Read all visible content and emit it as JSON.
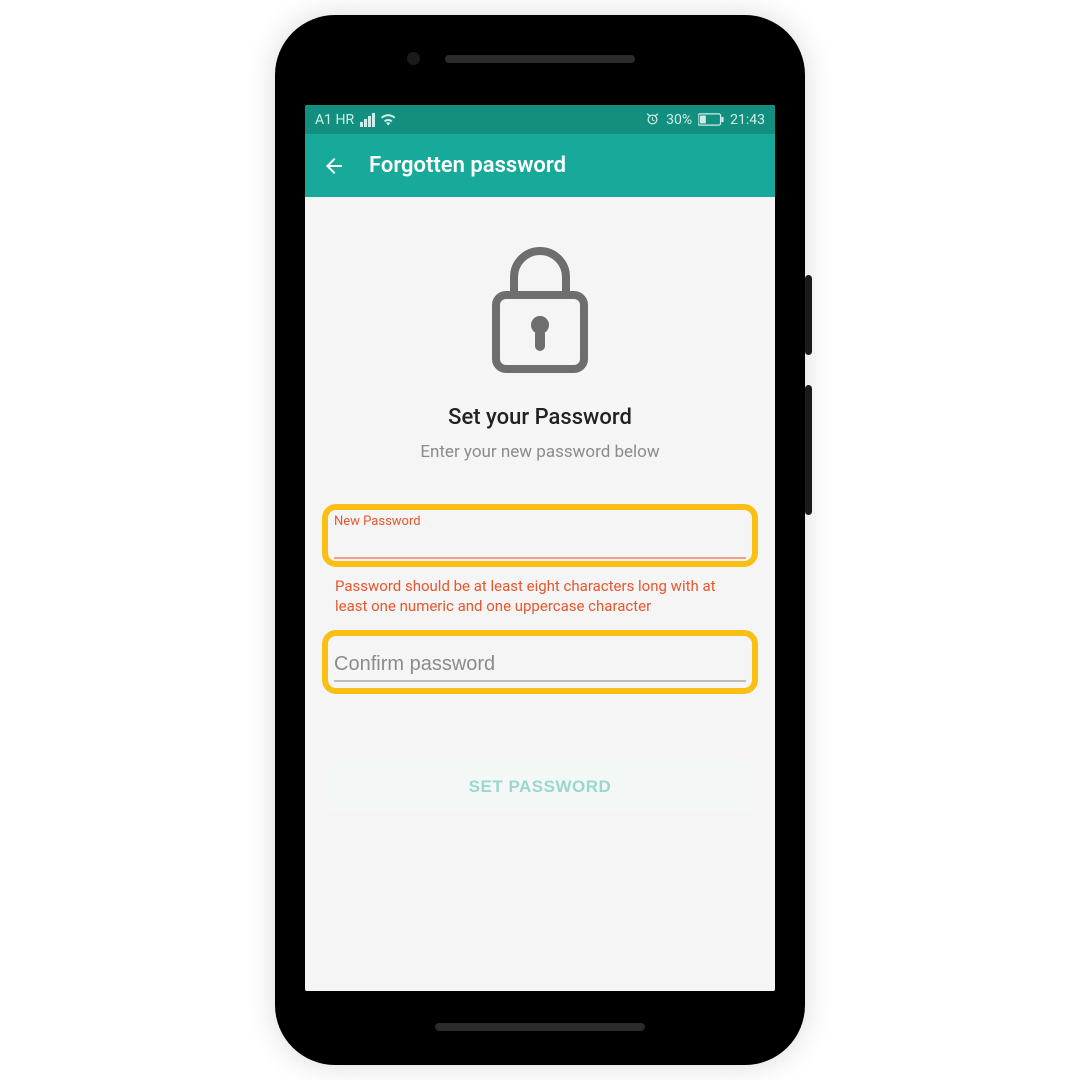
{
  "statusbar": {
    "carrier": "A1 HR",
    "battery_pct": "30%",
    "clock": "21:43"
  },
  "appbar": {
    "title": "Forgotten password"
  },
  "main": {
    "heading": "Set your Password",
    "subheading": "Enter your new password below",
    "new_password": {
      "float_label": "New Password",
      "value": ""
    },
    "error_text": "Password should be at least eight characters long with at least one numeric and one uppercase character",
    "confirm_password": {
      "placeholder": "Confirm password",
      "value": ""
    },
    "cta_label": "SET PASSWORD"
  },
  "colors": {
    "brand": "#17a999",
    "brand_dark": "#138f7f",
    "highlight": "#f9bf14",
    "error": "#e6572d"
  }
}
